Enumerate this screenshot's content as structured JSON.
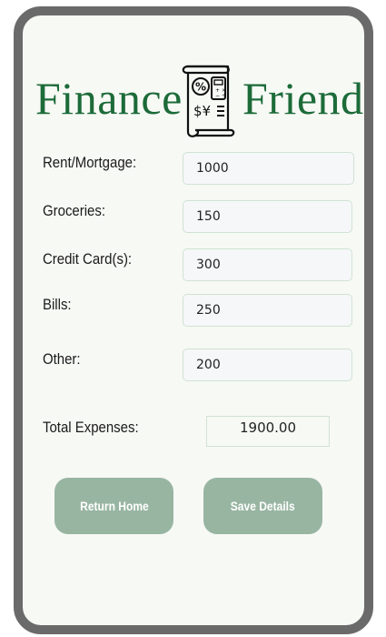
{
  "header": {
    "title_left": "Finance",
    "title_right": "Friend",
    "logo_icon": "receipt-calculator-icon",
    "accent_color": "#1c6b39"
  },
  "form": {
    "rent_label": "Rent/Mortgage:",
    "rent_value": "1000",
    "groceries_label": "Groceries:",
    "groceries_value": "150",
    "credit_label": "Credit Card(s):",
    "credit_value": "300",
    "bills_label": "Bills:",
    "bills_value": "250",
    "other_label": "Other:",
    "other_value": "200"
  },
  "total": {
    "label": "Total Expenses:",
    "value": "1900.00"
  },
  "buttons": {
    "home_label": "Return Home",
    "save_label": "Save Details",
    "button_color": "#98b5a2"
  }
}
